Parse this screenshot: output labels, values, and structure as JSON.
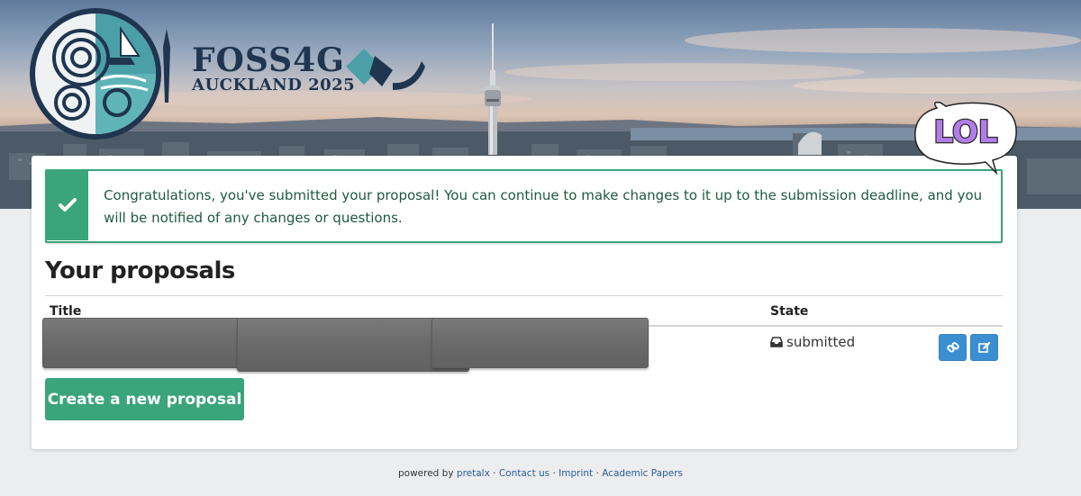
{
  "header": {
    "logo_title": "FOSS4G",
    "logo_subtitle": "AUCKLAND 2025"
  },
  "sticker": {
    "text": "LOL"
  },
  "alert": {
    "icon": "check-icon",
    "message": "Congratulations, you've submitted your proposal! You can continue to make changes to it up to the submission deadline, and you will be notified of any changes or questions."
  },
  "proposals": {
    "heading": "Your proposals",
    "columns": {
      "title": "Title",
      "state": "State"
    },
    "rows": [
      {
        "title": "",
        "state_icon": "inbox-icon",
        "state": "submitted",
        "actions": [
          "link-icon",
          "edit-icon"
        ]
      }
    ],
    "create_label": "Create a new proposal"
  },
  "footer": {
    "powered_prefix": "powered by",
    "powered_link": "pretalx",
    "separator": " · ",
    "links": [
      "Contact us",
      "Imprint",
      "Academic Papers"
    ]
  },
  "colors": {
    "success": "#3aa57a",
    "primary": "#3a8fd0",
    "background": "#ecedef",
    "logo_teal": "#4ba0a8",
    "logo_navy": "#1f3550"
  }
}
